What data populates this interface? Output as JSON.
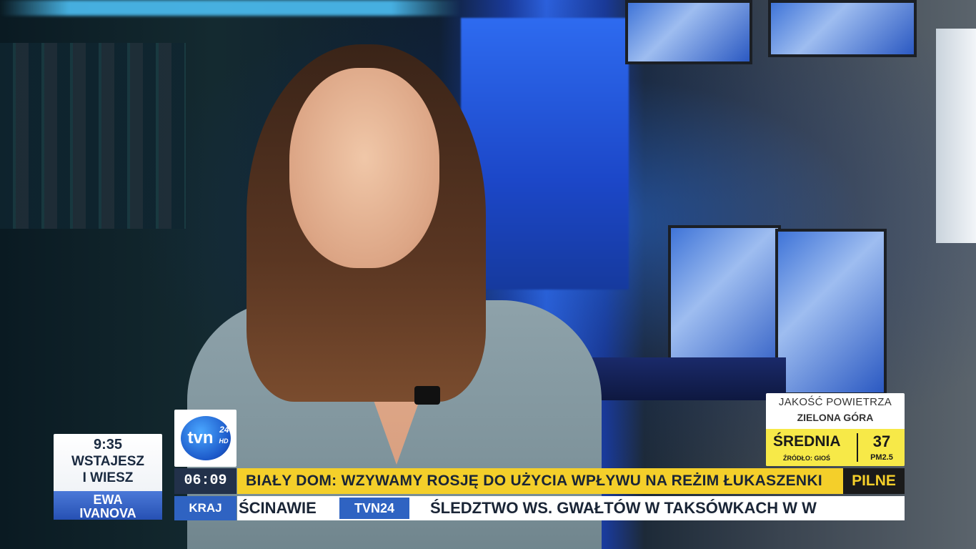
{
  "clock": {
    "time": "9:35",
    "show_line1": "WSTAJESZ",
    "show_line2": "I WIESZ",
    "host_line1": "EWA",
    "host_line2": "IVANOVA"
  },
  "logo": {
    "text": "tvn",
    "number": "24",
    "badge": "HD"
  },
  "lower_third": {
    "time": "06:09",
    "headline": "BIAŁY DOM: WZYWAMY ROSJĘ DO UŻYCIA WPŁYWU NA REŻIM ŁUKASZENKI",
    "flag": "PILNE",
    "section": "KRAJ",
    "ticker_prev": "ŚCINAWIE",
    "ticker_badge": "TVN24",
    "ticker_next": "ŚLEDZTWO WS. GWAŁTÓW W TAKSÓWKACH W W"
  },
  "air_quality": {
    "title": "JAKOŚĆ POWIETRZA",
    "city": "ZIELONA GÓRA",
    "level": "ŚREDNIA",
    "source": "ŹRÓDŁO: GIOŚ",
    "value": "37",
    "unit": "PM2.5"
  },
  "colors": {
    "headline_bg": "#f4cf2a",
    "brand_blue": "#2f63c2",
    "dark_bar": "#22314a",
    "aq_band": "#f7e948"
  }
}
